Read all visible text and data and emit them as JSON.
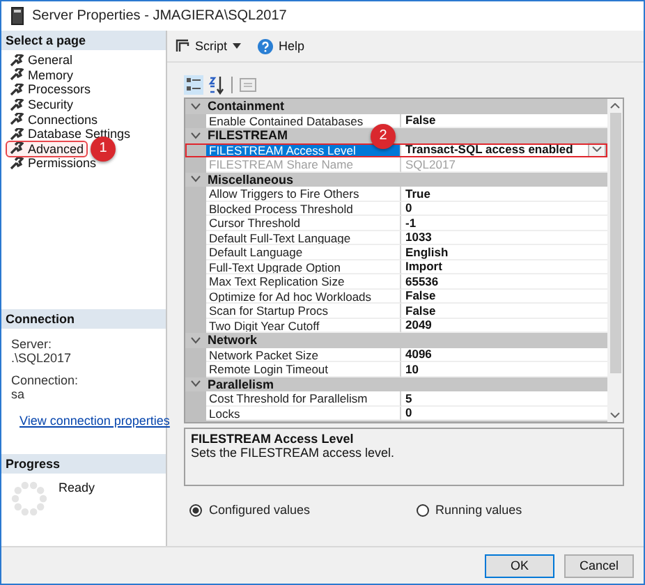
{
  "window": {
    "title": "Server Properties - JMAGIERA\\SQL2017"
  },
  "sidebar": {
    "header": "Select a page",
    "items": [
      {
        "label": "General",
        "selected": false,
        "highlighted": false
      },
      {
        "label": "Memory",
        "selected": false,
        "highlighted": false
      },
      {
        "label": "Processors",
        "selected": false,
        "highlighted": false
      },
      {
        "label": "Security",
        "selected": false,
        "highlighted": false
      },
      {
        "label": "Connections",
        "selected": false,
        "highlighted": false
      },
      {
        "label": "Database Settings",
        "selected": false,
        "highlighted": false
      },
      {
        "label": "Advanced",
        "selected": true,
        "highlighted": true,
        "badge": "1"
      },
      {
        "label": "Permissions",
        "selected": false,
        "highlighted": false
      }
    ]
  },
  "connection": {
    "header": "Connection",
    "server_label": "Server:",
    "server": ".\\SQL2017",
    "connection_label": "Connection:",
    "connection": "sa",
    "link": "View connection properties"
  },
  "progress": {
    "header": "Progress",
    "status": "Ready"
  },
  "toolbar": {
    "script": "Script",
    "help": "Help"
  },
  "property_grid": {
    "categories": [
      {
        "name": "Containment",
        "expanded": true,
        "rows": [
          {
            "name": "Enable Contained Databases",
            "value": "False",
            "kind": "text",
            "selected": false,
            "disabled": false,
            "highlighted": false
          }
        ]
      },
      {
        "name": "FILESTREAM",
        "expanded": true,
        "rows": [
          {
            "name": "FILESTREAM Access Level",
            "value": "Transact-SQL access enabled",
            "kind": "dropdown",
            "selected": true,
            "disabled": false,
            "highlighted": true,
            "badge": "2"
          },
          {
            "name": "FILESTREAM Share Name",
            "value": "SQL2017",
            "kind": "text",
            "selected": false,
            "disabled": true,
            "highlighted": false
          }
        ]
      },
      {
        "name": "Miscellaneous",
        "expanded": true,
        "rows": [
          {
            "name": "Allow Triggers to Fire Others",
            "value": "True",
            "kind": "text",
            "selected": false,
            "disabled": false,
            "highlighted": false
          },
          {
            "name": "Blocked Process Threshold",
            "value": "0",
            "kind": "text",
            "selected": false,
            "disabled": false,
            "highlighted": false
          },
          {
            "name": "Cursor Threshold",
            "value": "-1",
            "kind": "text",
            "selected": false,
            "disabled": false,
            "highlighted": false
          },
          {
            "name": "Default Full-Text Language",
            "value": "1033",
            "kind": "text",
            "selected": false,
            "disabled": false,
            "highlighted": false
          },
          {
            "name": "Default Language",
            "value": "English",
            "kind": "text",
            "selected": false,
            "disabled": false,
            "highlighted": false
          },
          {
            "name": "Full-Text Upgrade Option",
            "value": "Import",
            "kind": "text",
            "selected": false,
            "disabled": false,
            "highlighted": false
          },
          {
            "name": "Max Text Replication Size",
            "value": "65536",
            "kind": "text",
            "selected": false,
            "disabled": false,
            "highlighted": false
          },
          {
            "name": "Optimize for Ad hoc Workloads",
            "value": "False",
            "kind": "text",
            "selected": false,
            "disabled": false,
            "highlighted": false
          },
          {
            "name": "Scan for Startup Procs",
            "value": "False",
            "kind": "text",
            "selected": false,
            "disabled": false,
            "highlighted": false
          },
          {
            "name": "Two Digit Year Cutoff",
            "value": "2049",
            "kind": "text",
            "selected": false,
            "disabled": false,
            "highlighted": false
          }
        ]
      },
      {
        "name": "Network",
        "expanded": true,
        "rows": [
          {
            "name": "Network Packet Size",
            "value": "4096",
            "kind": "text",
            "selected": false,
            "disabled": false,
            "highlighted": false
          },
          {
            "name": "Remote Login Timeout",
            "value": "10",
            "kind": "text",
            "selected": false,
            "disabled": false,
            "highlighted": false
          }
        ]
      },
      {
        "name": "Parallelism",
        "expanded": true,
        "rows": [
          {
            "name": "Cost Threshold for Parallelism",
            "value": "5",
            "kind": "text",
            "selected": false,
            "disabled": false,
            "highlighted": false
          },
          {
            "name": "Locks",
            "value": "0",
            "kind": "text",
            "selected": false,
            "disabled": false,
            "highlighted": false
          }
        ]
      }
    ]
  },
  "description": {
    "title": "FILESTREAM Access Level",
    "text": "Sets the FILESTREAM access level."
  },
  "value_mode": [
    {
      "label": "Configured values",
      "selected": true
    },
    {
      "label": "Running values",
      "selected": false
    }
  ],
  "buttons": [
    {
      "label": "OK",
      "default": true
    },
    {
      "label": "Cancel",
      "default": false
    }
  ]
}
